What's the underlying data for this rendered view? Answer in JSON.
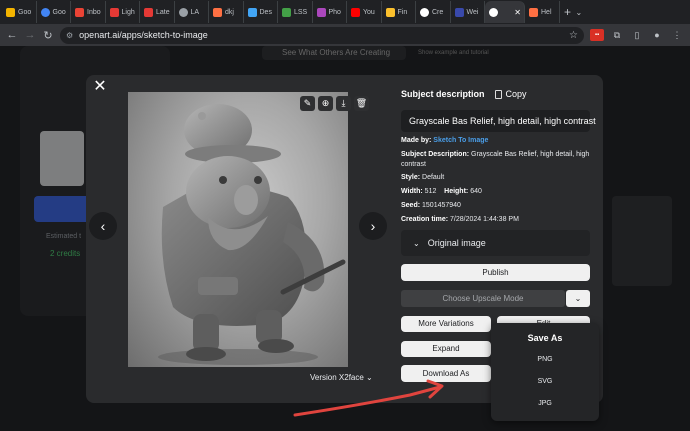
{
  "browser": {
    "tabs": [
      {
        "label": "Goo",
        "color": "#f4b400"
      },
      {
        "label": "Goo",
        "color": "#4285f4"
      },
      {
        "label": "Inbo",
        "color": "#ea4335"
      },
      {
        "label": "Ligh",
        "color": "#e53935"
      },
      {
        "label": "Late",
        "color": "#e53935"
      },
      {
        "label": "LA",
        "color": "#9aa0a6"
      },
      {
        "label": "dkj",
        "color": "#ff7043"
      },
      {
        "label": "Des",
        "color": "#42a5f5"
      },
      {
        "label": "LSS",
        "color": "#43a047"
      },
      {
        "label": "Pho",
        "color": "#ab47bc"
      },
      {
        "label": "You",
        "color": "#ff0000"
      },
      {
        "label": "Fin",
        "color": "#fbc02d"
      },
      {
        "label": "Cre",
        "color": "#ffffff"
      },
      {
        "label": "Wei",
        "color": "#3949ab"
      },
      {
        "label": "",
        "color": "#ffffff",
        "active": true
      },
      {
        "label": "Hel",
        "color": "#ff7043"
      }
    ],
    "url": "openart.ai/apps/sketch-to-image"
  },
  "background": {
    "top_button": "See What Others Are Creating",
    "top_note": "Show example and tutorial",
    "estimated": "Estimated t",
    "credits": "2 credits"
  },
  "modal": {
    "subject_heading": "Subject description",
    "copy_label": "Copy",
    "prompt": "Grayscale Bas Relief, high detail, high contrast",
    "made_by_label": "Made by:",
    "made_by_value": "Sketch To Image",
    "subject_desc_label": "Subject Description:",
    "subject_desc_value": "Grayscale Bas Relief, high detail, high contrast",
    "style_label": "Style:",
    "style_value": "Default",
    "width_label": "Width:",
    "width_value": "512",
    "height_label": "Height:",
    "height_value": "640",
    "seed_label": "Seed:",
    "seed_value": "1501457940",
    "creation_label": "Creation time:",
    "creation_value": "7/28/2024 1:44:38 PM",
    "original_image": "Original image",
    "publish": "Publish",
    "upscale": "Choose Upscale Mode",
    "more_variations": "More Variations",
    "edit": "Edit",
    "expand": "Expand",
    "download_as": "Download As",
    "version": "Version X2face"
  },
  "save_as": {
    "title": "Save As",
    "options": [
      "PNG",
      "SVG",
      "JPG"
    ]
  },
  "colors": {
    "link": "#4a9ee8",
    "annotation_arrow": "#e0443e"
  }
}
